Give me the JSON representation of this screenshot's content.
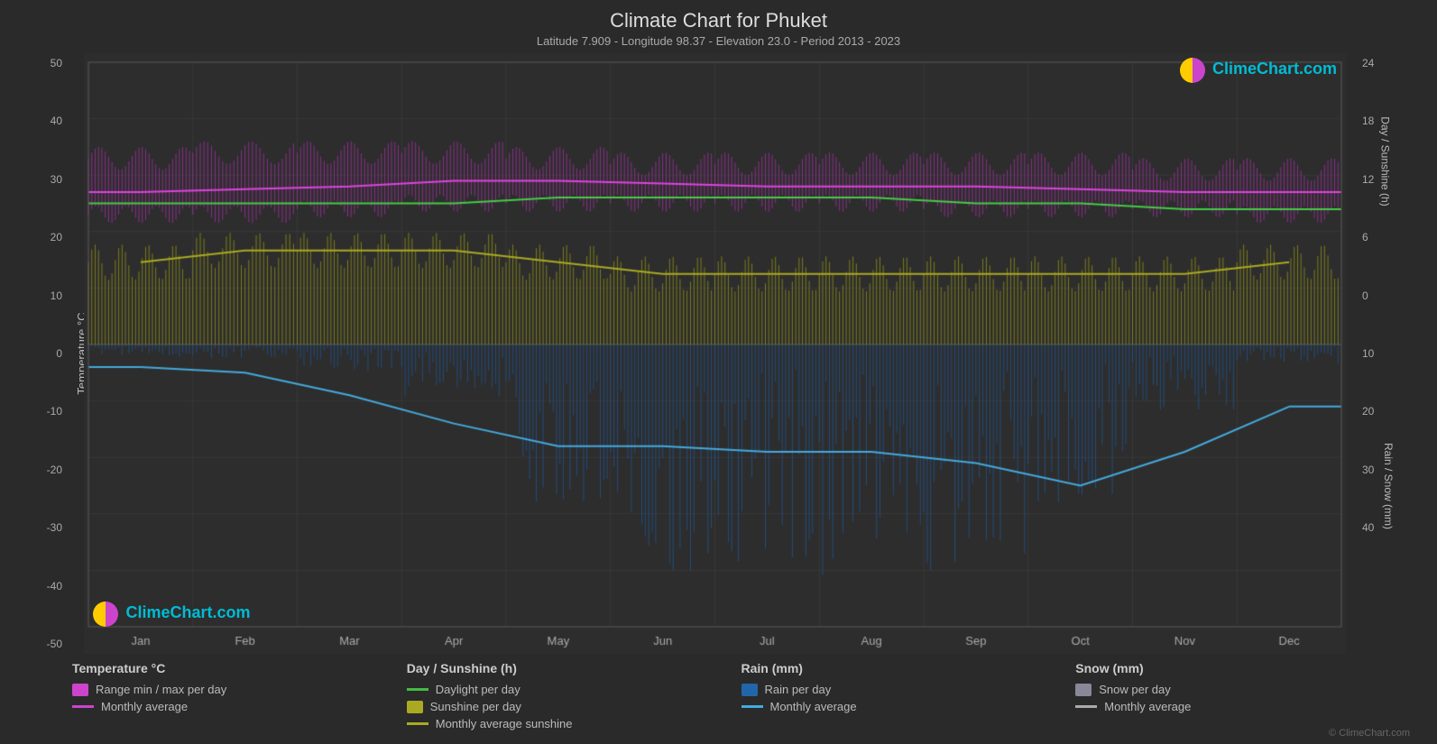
{
  "title": "Climate Chart for Phuket",
  "subtitle": "Latitude 7.909 - Longitude 98.37 - Elevation 23.0 - Period 2013 - 2023",
  "watermark": "© ClimeChart.com",
  "logo_text": "ClimeChart.com",
  "y_axis_left_label": "Temperature °C",
  "y_axis_right_top_label": "Day / Sunshine (h)",
  "y_axis_right_bottom_label": "Rain / Snow (mm)",
  "months": [
    "Jan",
    "Feb",
    "Mar",
    "Apr",
    "May",
    "Jun",
    "Jul",
    "Aug",
    "Sep",
    "Oct",
    "Nov",
    "Dec"
  ],
  "legend": {
    "col1": {
      "title": "Temperature °C",
      "items": [
        {
          "type": "swatch",
          "color": "#cc44cc",
          "label": "Range min / max per day"
        },
        {
          "type": "line",
          "color": "#cc44cc",
          "label": "Monthly average"
        }
      ]
    },
    "col2": {
      "title": "Day / Sunshine (h)",
      "items": [
        {
          "type": "line",
          "color": "#44bb44",
          "label": "Daylight per day"
        },
        {
          "type": "swatch",
          "color": "#aaaa22",
          "label": "Sunshine per day"
        },
        {
          "type": "line",
          "color": "#aaaa22",
          "label": "Monthly average sunshine"
        }
      ]
    },
    "col3": {
      "title": "Rain (mm)",
      "items": [
        {
          "type": "swatch",
          "color": "#2266aa",
          "label": "Rain per day"
        },
        {
          "type": "line",
          "color": "#44aadd",
          "label": "Monthly average"
        }
      ]
    },
    "col4": {
      "title": "Snow (mm)",
      "items": [
        {
          "type": "swatch",
          "color": "#888899",
          "label": "Snow per day"
        },
        {
          "type": "line",
          "color": "#aaaaaa",
          "label": "Monthly average"
        }
      ]
    }
  }
}
